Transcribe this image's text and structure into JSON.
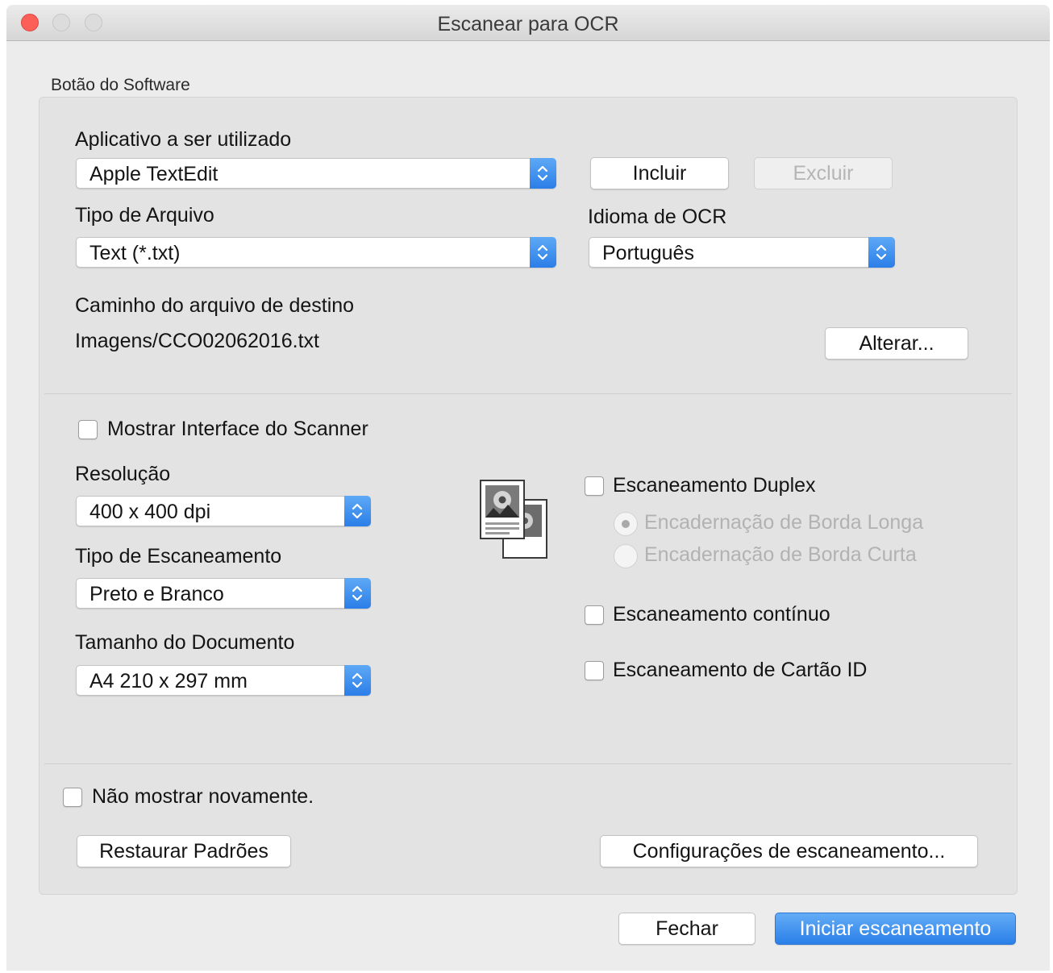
{
  "window": {
    "title": "Escanear para OCR"
  },
  "group_label": "Botão do Software",
  "application": {
    "label": "Aplicativo a ser utilizado",
    "selected": "Apple TextEdit",
    "add_button": "Incluir",
    "remove_button": "Excluir"
  },
  "file_type": {
    "label": "Tipo de Arquivo",
    "selected": "Text (*.txt)"
  },
  "ocr_language": {
    "label": "Idioma de OCR",
    "selected": "Português"
  },
  "destination": {
    "label": "Caminho do arquivo de destino",
    "path": "Imagens/CCO02062016.txt",
    "change_button": "Alterar..."
  },
  "show_scanner_interface": {
    "label": "Mostrar Interface do Scanner",
    "checked": false
  },
  "resolution": {
    "label": "Resolução",
    "selected": "400 x 400 dpi"
  },
  "scan_type": {
    "label": "Tipo de Escaneamento",
    "selected": "Preto e Branco"
  },
  "document_size": {
    "label": "Tamanho do Documento",
    "selected": "A4 210 x 297 mm"
  },
  "duplex": {
    "label": "Escaneamento Duplex",
    "checked": false,
    "long_edge": "Encadernação de Borda Longa",
    "short_edge": "Encadernação de Borda Curta"
  },
  "continuous_scan": {
    "label": "Escaneamento contínuo",
    "checked": false
  },
  "id_card_scan": {
    "label": "Escaneamento de Cartão ID",
    "checked": false
  },
  "dont_show_again": {
    "label": "Não mostrar novamente.",
    "checked": false
  },
  "buttons": {
    "restore_defaults": "Restaurar Padrões",
    "scan_settings": "Configurações de escaneamento...",
    "close": "Fechar",
    "start_scan": "Iniciar escaneamento"
  },
  "colors": {
    "accent": "#2b7ee8",
    "close_light": "#fb5f57"
  }
}
